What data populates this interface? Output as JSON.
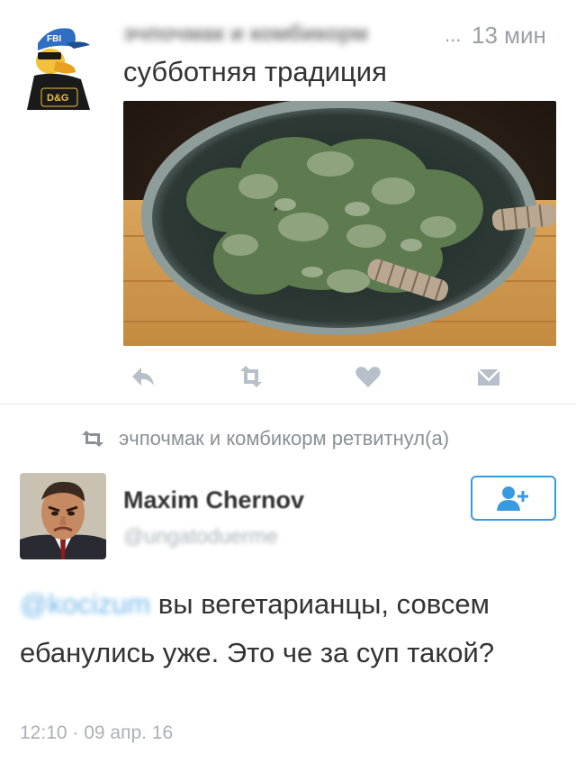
{
  "tweet": {
    "author_name": "эчпочмак и комбикорм",
    "ellipsis": "...",
    "time": "13 мин",
    "text": "субботняя традиция",
    "avatar": {
      "badge_top": "FBI",
      "badge_bottom": "D&G"
    },
    "photo": {
      "subject": "banya-venik-in-basin"
    },
    "actions": {
      "reply_icon": "reply-icon",
      "retweet_icon": "retweet-icon",
      "like_icon": "heart-icon",
      "dm_icon": "dm-icon"
    }
  },
  "retweet_notice": {
    "icon": "retweet-icon",
    "text": "эчпочмак и комбикорм ретвитнул(а)"
  },
  "reply": {
    "author_name": "Maxim Chernov",
    "handle": "@ungatoduerme",
    "follow_icon": "follow-user-icon",
    "mention": "@kocizum",
    "text_after_mention": " вы вегетарианцы, совсем ебанулись уже. Это че за суп такой?",
    "timestamp": "12:10 · 09 апр. 16"
  },
  "colors": {
    "accent": "#3a9ae0",
    "muted": "#9aa0a6",
    "text": "#333333",
    "divider": "#e6e8ea"
  }
}
